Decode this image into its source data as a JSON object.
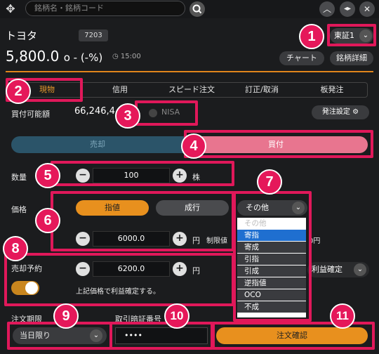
{
  "search": {
    "placeholder": "銘柄名・銘柄コード"
  },
  "stock": {
    "name": "トヨタ",
    "code": "7203",
    "price": "5,800.0",
    "price_suffix": "o - (-%)",
    "time": "15:00"
  },
  "market": {
    "selected": "東証1"
  },
  "buttons": {
    "chart": "チャート",
    "detail": "銘柄詳細"
  },
  "tabs": [
    {
      "label": "現物"
    },
    {
      "label": "信用"
    },
    {
      "label": "スピード注文"
    },
    {
      "label": "訂正/取消"
    },
    {
      "label": "板発注"
    }
  ],
  "buying_power": {
    "label": "買付可能額",
    "value": "66,246,4",
    "nisa_label": "NISA",
    "settings_label": "発注設定"
  },
  "side": {
    "sell": "売却",
    "buy": "買付"
  },
  "quantity": {
    "label": "数量",
    "value": "100",
    "unit": "株"
  },
  "price_row": {
    "label": "価格",
    "limit": "指値",
    "market": "成行",
    "other": "その他",
    "value": "6000.0",
    "unit": "円",
    "limit_price_label": "制限値",
    "right_value": "0円"
  },
  "dropdown": {
    "items": [
      "その他",
      "寄指",
      "寄成",
      "引指",
      "引成",
      "逆指値",
      "OCO",
      "不成"
    ],
    "selected_index": 1
  },
  "sell_reservation": {
    "label": "売却予約",
    "value": "6200.0",
    "unit": "円",
    "note": "上記価格で利益確定する。",
    "right_select": "利益確定"
  },
  "order_period": {
    "label": "注文期限",
    "value": "当日限り"
  },
  "pin": {
    "label": "取引暗証番号",
    "value": "••••"
  },
  "confirm": {
    "label": "注文確認"
  },
  "callouts": [
    "1",
    "2",
    "3",
    "4",
    "5",
    "6",
    "7",
    "8",
    "9",
    "10",
    "11"
  ],
  "colors": {
    "accent_orange": "#e8901e",
    "callout_pink": "#e0185a",
    "buy_pink": "#e8758f",
    "sell_blue": "#2b5469",
    "select_blue": "#1f6fd0"
  }
}
